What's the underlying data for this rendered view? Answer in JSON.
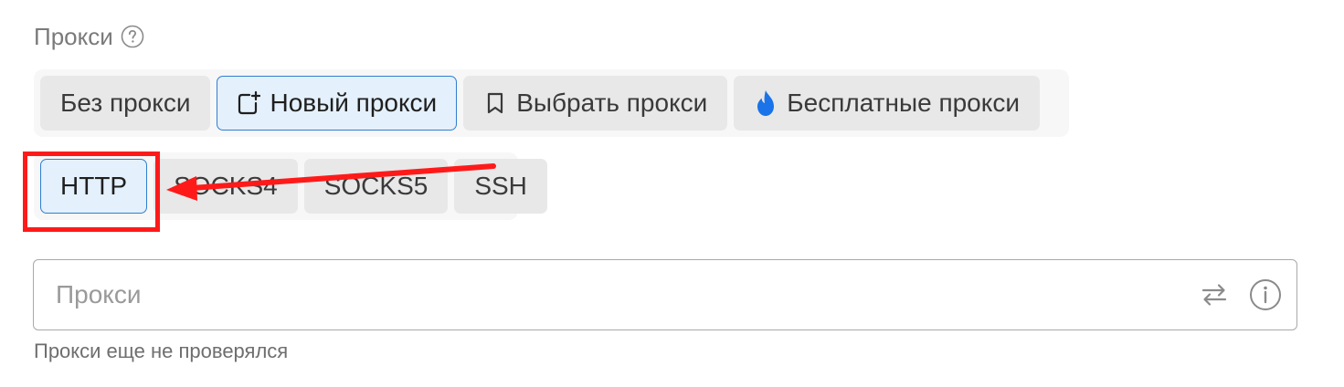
{
  "section": {
    "label": "Прокси",
    "help_icon": "question-circle-icon"
  },
  "mode_options": [
    {
      "label": "Без прокси",
      "icon": null,
      "active": false
    },
    {
      "label": "Новый прокси",
      "icon": "add-square-icon",
      "active": true
    },
    {
      "label": "Выбрать прокси",
      "icon": "bookmark-icon",
      "active": false
    },
    {
      "label": "Бесплатные прокси",
      "icon": "flame-icon",
      "active": false
    }
  ],
  "type_options": [
    {
      "label": "HTTP",
      "active": true
    },
    {
      "label": "SOCKS4",
      "active": false
    },
    {
      "label": "SOCKS5",
      "active": false
    },
    {
      "label": "SSH",
      "active": false
    }
  ],
  "proxy_input": {
    "value": "",
    "placeholder": "Прокси",
    "icons": [
      "swap-icon",
      "info-circle-icon"
    ]
  },
  "status": "Прокси еще не проверялся",
  "colors": {
    "accent": "#2f7fd1",
    "active_bg": "#e4f0fb",
    "flame": "#1a73e8",
    "annotation": "#ff1a1a"
  }
}
